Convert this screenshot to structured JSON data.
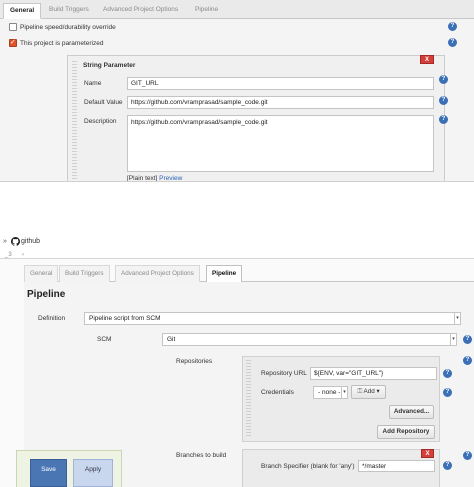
{
  "top": {
    "tabs": [
      {
        "label": "General",
        "active": true
      },
      {
        "label": "Build Triggers",
        "active": false
      },
      {
        "label": "Advanced Project Options",
        "active": false
      },
      {
        "label": "Pipeline",
        "active": false
      }
    ],
    "durability_override_label": "Pipeline speed/durability override",
    "parameterized_label": "This project is parameterized",
    "string_param": {
      "title": "String Parameter",
      "remove_label": "X",
      "name_label": "Name",
      "name_value": "GIT_URL",
      "default_label": "Default Value",
      "default_value": "https://github.com/vramprasad/sample_code.git",
      "description_label": "Description",
      "description_value": "https://github.com/vramprasad/sample_code.git",
      "plain_text": "[Plain text]",
      "preview": "Preview"
    }
  },
  "bottom": {
    "breadcrumb_sep": "»",
    "repo_name": "github",
    "line_prefix": "_3",
    "line_arrow": "›",
    "tabs": [
      {
        "label": "General",
        "active": false
      },
      {
        "label": "Build Triggers",
        "active": false
      },
      {
        "label": "Advanced Project Options",
        "active": false
      },
      {
        "label": "Pipeline",
        "active": true
      }
    ],
    "section_title": "Pipeline",
    "definition_label": "Definition",
    "definition_value": "Pipeline script from SCM",
    "scm_label": "SCM",
    "scm_value": "Git",
    "repositories_label": "Repositories",
    "repo_url_label": "Repository URL",
    "repo_url_value": "${ENV, var=\"GIT_URL\"}",
    "credentials_label": "Credentials",
    "credentials_value": "- none -",
    "add_label": "Add",
    "advanced_label": "Advanced...",
    "add_repository_label": "Add Repository",
    "branches_label": "Branches to build",
    "branch_specifier_label": "Branch Specifier (blank for 'any')",
    "branch_specifier_value": "*/master",
    "remove_label": "X",
    "save_label": "Save",
    "apply_label": "Apply"
  }
}
